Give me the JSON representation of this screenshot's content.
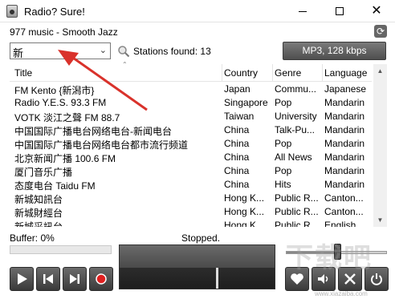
{
  "window": {
    "title": "Radio? Sure!",
    "icon": "radio-app-icon"
  },
  "station": {
    "name": "977 music - Smooth Jazz"
  },
  "search": {
    "value": "新",
    "stations_found": "Stations found: 13"
  },
  "format": {
    "label": "MP3, 128 kbps"
  },
  "table": {
    "headers": {
      "title": "Title",
      "country": "Country",
      "genre": "Genre",
      "language": "Language"
    },
    "rows": [
      {
        "title": "FM Kento {新潟市}",
        "country": "Japan",
        "genre": "Commu...",
        "language": "Japanese"
      },
      {
        "title": "Radio Y.E.S. 93.3 FM",
        "country": "Singapore",
        "genre": "Pop",
        "language": "Mandarin"
      },
      {
        "title": "VOTK 淡江之聲 FM 88.7",
        "country": "Taiwan",
        "genre": "University",
        "language": "Mandarin"
      },
      {
        "title": "中国国际广播电台网络电台-新闻电台",
        "country": "China",
        "genre": "Talk-Pu...",
        "language": "Mandarin"
      },
      {
        "title": "中国国际广播电台网络电台都市流行频道",
        "country": "China",
        "genre": "Pop",
        "language": "Mandarin"
      },
      {
        "title": "北京新闻广播 100.6 FM",
        "country": "China",
        "genre": "All News",
        "language": "Mandarin"
      },
      {
        "title": "厦门音乐广播",
        "country": "China",
        "genre": "Pop",
        "language": "Mandarin"
      },
      {
        "title": "态度电台 Taidu FM",
        "country": "China",
        "genre": "Hits",
        "language": "Mandarin"
      },
      {
        "title": "新城知訊台",
        "country": "Hong K...",
        "genre": "Public R...",
        "language": "Canton..."
      },
      {
        "title": "新城財經台",
        "country": "Hong K...",
        "genre": "Public R...",
        "language": "Canton..."
      },
      {
        "title": "新城采訊台",
        "country": "Hong K...",
        "genre": "Public R...",
        "language": "English"
      }
    ]
  },
  "status": {
    "buffer": "Buffer: 0%",
    "buffer_value": 0,
    "state": "Stopped."
  },
  "volume": {
    "level": 0.49
  },
  "watermark": {
    "text": "下载吧",
    "sub": "www.xiazaiba.com"
  },
  "icons": {
    "play": "play-icon",
    "prev": "previous-icon",
    "next": "next-icon",
    "record": "record-icon",
    "favorite": "heart-icon",
    "volume": "speaker-icon",
    "tools": "tools-icon",
    "power": "power-icon",
    "search": "magnifier-icon",
    "refresh": "refresh-icon"
  },
  "colors": {
    "accent_blue": "#5c9bd6",
    "button_dark": "#4f4f4f",
    "record_red": "#e02020",
    "arrow_red": "#d9322b"
  }
}
